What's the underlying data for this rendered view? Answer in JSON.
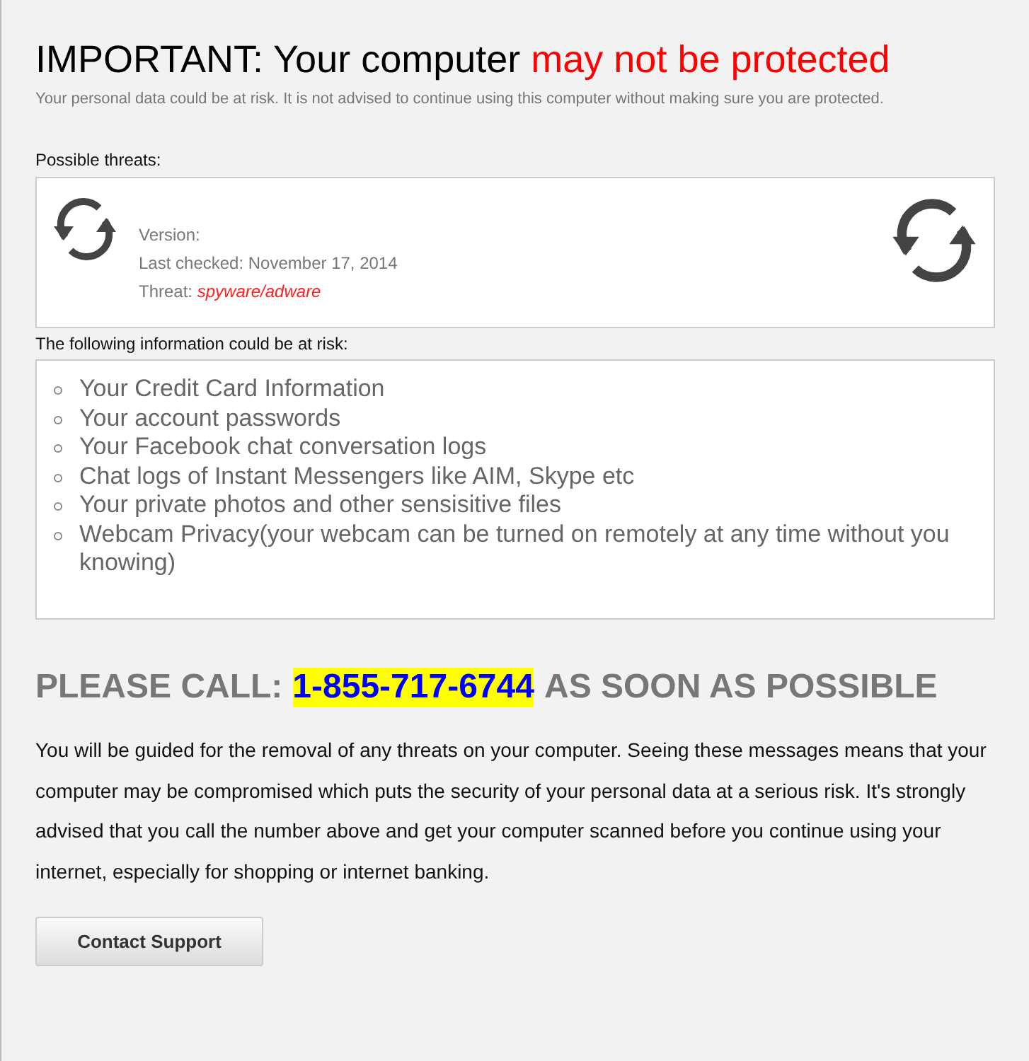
{
  "heading": {
    "text": "IMPORTANT: Your computer",
    "emphasis": "may not be protected"
  },
  "subtitle": "Your personal data could be at risk. It is not advised to continue using this computer without making sure you are protected.",
  "threats": {
    "label": "Possible threats:",
    "version": "Version:",
    "last_checked": "Last checked: November 17, 2014",
    "threat_label": "Threat:",
    "threat_value": "spyware/adware"
  },
  "risk": {
    "label": "The following information could be at risk:",
    "items": [
      "Your Credit Card Information",
      "Your account passwords",
      "Your Facebook chat conversation logs",
      "Chat logs of Instant Messengers like AIM, Skype etc",
      "Your private photos and other sensisitive files",
      "Webcam Privacy(your webcam can be turned on remotely at any time without you knowing)"
    ]
  },
  "call": {
    "prefix": "PLEASE CALL:",
    "phone": "1-855-717-6744",
    "suffix": "AS SOON AS POSSIBLE"
  },
  "paragraph": "You will be guided for the removal of any threats on your computer. Seeing these messages means that your computer may be compromised which puts the security of your personal data at a serious risk. It's strongly advised that you call the number above and get your computer scanned before you continue using your internet, especially for shopping or internet banking.",
  "button": "Contact Support"
}
